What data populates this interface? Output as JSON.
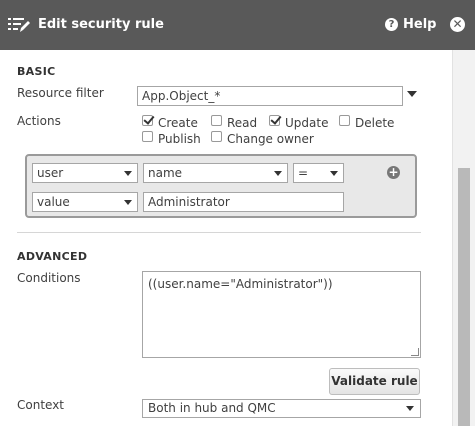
{
  "header": {
    "title": "Edit security rule",
    "help_label": "Help",
    "help_icon_glyph": "?",
    "close_icon_glyph": "✕"
  },
  "basic": {
    "section_title": "BASIC",
    "resource_filter_label": "Resource filter",
    "resource_filter_value": "App.Object_*",
    "actions_label": "Actions",
    "actions": [
      {
        "label": "Create",
        "checked": true
      },
      {
        "label": "Read",
        "checked": false
      },
      {
        "label": "Update",
        "checked": true
      },
      {
        "label": "Delete",
        "checked": false
      },
      {
        "label": "Publish",
        "checked": false
      },
      {
        "label": "Change owner",
        "checked": false
      }
    ]
  },
  "builder": {
    "row1": {
      "subject": "user",
      "attribute": "name",
      "operator": "="
    },
    "row2": {
      "type": "value",
      "value": "Administrator"
    },
    "add_icon_glyph": "+"
  },
  "advanced": {
    "section_title": "ADVANCED",
    "conditions_label": "Conditions",
    "conditions_value": "((user.name=\"Administrator\"))",
    "validate_button": "Validate rule",
    "context_label": "Context",
    "context_value": "Both in hub and QMC"
  },
  "icons": {
    "title_icon": "edit-list-icon",
    "help_icon": "help-icon",
    "close_icon": "close-icon",
    "add_icon": "plus-icon"
  },
  "colors": {
    "header_bg": "#595959",
    "builder_bg": "#e8e8e8"
  }
}
